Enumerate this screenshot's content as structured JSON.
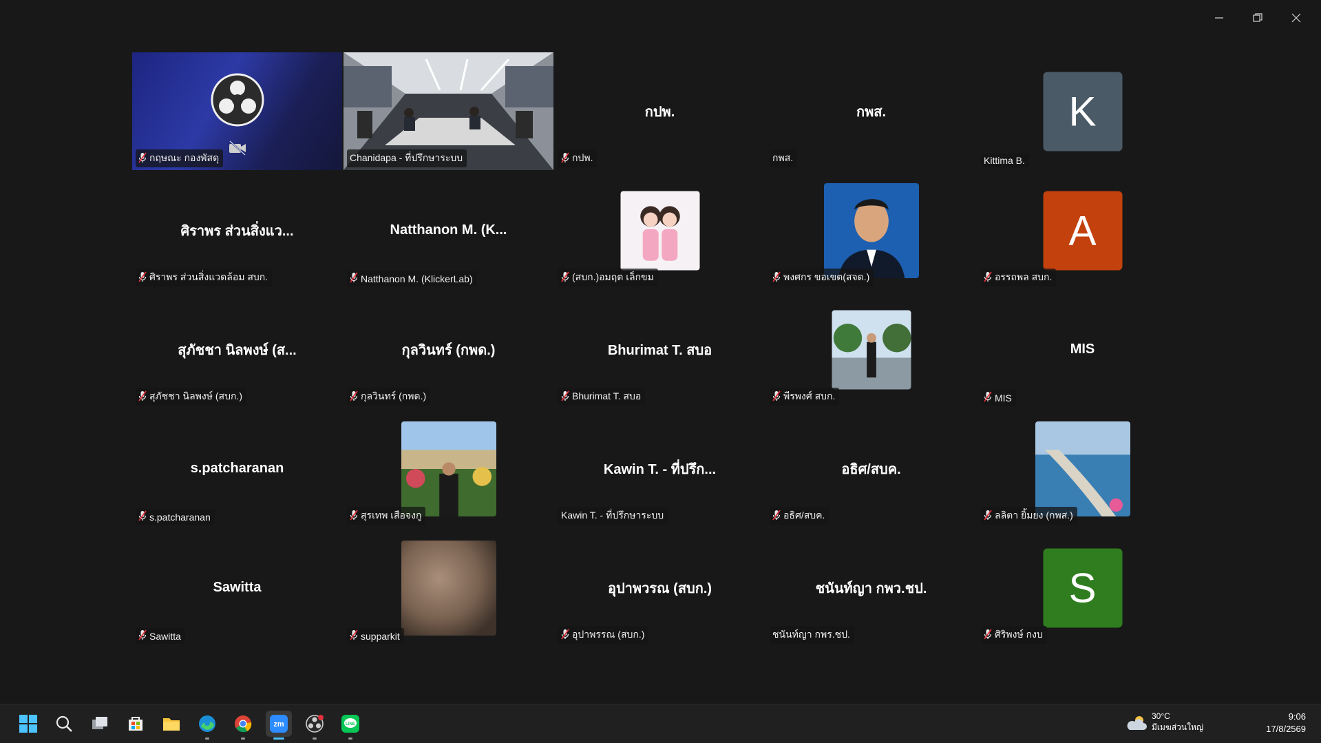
{
  "window": {
    "minimize": "minimize",
    "restore": "restore",
    "close": "close"
  },
  "participants": [
    {
      "label": "กฤษณะ กองพัสดุ",
      "muted": true,
      "kind": "obs"
    },
    {
      "label": "Chanidapa - ที่ปรึกษาระบบ",
      "muted": false,
      "kind": "room",
      "active": true
    },
    {
      "label": "กปพ.",
      "muted": true,
      "kind": "name",
      "display": "กปพ."
    },
    {
      "label": "กพส.",
      "muted": false,
      "kind": "name",
      "display": "กพส."
    },
    {
      "label": "Kittima B.",
      "muted": false,
      "kind": "avatar",
      "letter": "K",
      "color": "#4a5a66"
    },
    {
      "label": "ศิราพร ส่วนสิ่งแวดล้อม สบก.",
      "muted": true,
      "kind": "name",
      "display": "ศิราพร ส่วนสิ่งแว..."
    },
    {
      "label": "Natthanon M. (KlickerLab)",
      "muted": true,
      "kind": "name",
      "display": "Natthanon M. (K..."
    },
    {
      "label": "(สบก.)อมฤต เล็กขม",
      "muted": true,
      "kind": "photo",
      "photo": "cartoon"
    },
    {
      "label": "พงศกร ขอเขต(สจด.)",
      "muted": true,
      "kind": "photo",
      "photo": "portrait"
    },
    {
      "label": "อรรถพล สบก.",
      "muted": true,
      "kind": "avatar",
      "letter": "A",
      "color": "#c2410c"
    },
    {
      "label": "สุภัชชา นิลพงษ์ (สบก.)",
      "muted": true,
      "kind": "name",
      "display": "สุภัชชา นิลพงษ์ (ส..."
    },
    {
      "label": "กุลวินทร์ (กพด.)",
      "muted": true,
      "kind": "name",
      "display": "กุลวินทร์ (กพด.)"
    },
    {
      "label": "Bhurimat T. สบอ",
      "muted": true,
      "kind": "name",
      "display": "Bhurimat T. สบอ"
    },
    {
      "label": "พีรพงศ์ สบก.",
      "muted": true,
      "kind": "photo",
      "photo": "graduate"
    },
    {
      "label": "MIS",
      "muted": true,
      "kind": "name",
      "display": "MIS"
    },
    {
      "label": "s.patcharanan",
      "muted": true,
      "kind": "name",
      "display": "s.patcharanan"
    },
    {
      "label": "สุรเทพ เสือจงกู",
      "muted": true,
      "kind": "photo",
      "photo": "garden"
    },
    {
      "label": "Kawin T. - ที่ปรึกษาระบบ",
      "muted": false,
      "kind": "name",
      "display": "Kawin T. - ที่ปรึก..."
    },
    {
      "label": "อธิศ/สบค.",
      "muted": true,
      "kind": "name",
      "display": "อธิศ/สบค."
    },
    {
      "label": "ลลิตา ยิ้มยง (กพส.)",
      "muted": true,
      "kind": "photo",
      "photo": "coast"
    },
    {
      "label": "Sawitta",
      "muted": true,
      "kind": "name",
      "display": "Sawitta"
    },
    {
      "label": "supparkit",
      "muted": true,
      "kind": "photo",
      "photo": "blur"
    },
    {
      "label": "อุปาพรรณ (สบก.)",
      "muted": true,
      "kind": "name",
      "display": "อุปาพวรณ (สบก.)"
    },
    {
      "label": "ชนันท์ญา กพร.ชป.",
      "muted": false,
      "kind": "name",
      "display": "ชนันท์ญา กพว.ชป."
    },
    {
      "label": "ศิริพงษ์ กงบ",
      "muted": true,
      "kind": "avatar",
      "letter": "S",
      "color": "#2f7d1f"
    }
  ],
  "taskbar": {
    "apps": [
      "start",
      "search",
      "task-view",
      "store",
      "file-explorer",
      "edge",
      "chrome",
      "zoom",
      "obs",
      "line"
    ],
    "weather_temp": "30°C",
    "weather_text": "มีเมฆส่วนใหญ่",
    "time": "9:06",
    "date": "17/8/2569"
  }
}
